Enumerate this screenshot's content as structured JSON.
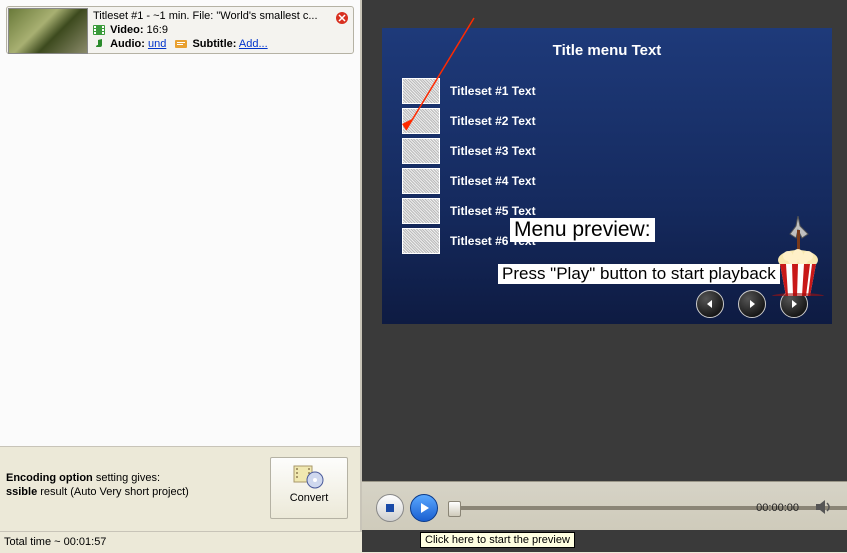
{
  "card": {
    "title": "Titleset #1 - ~1 min. File: \"World's smallest c...",
    "video_lbl": "Video:",
    "video_val": "16:9",
    "audio_lbl": "Audio:",
    "audio_link": "und",
    "subtitle_lbl": "Subtitle:",
    "subtitle_link": "Add..."
  },
  "encoding": {
    "line1_a": "Encoding option",
    "line1_b": " setting gives:",
    "line2_a": "ssible",
    "line2_b": " result (Auto Very short project)"
  },
  "convert_label": "Convert",
  "status": "Total time ~ 00:01:57",
  "dvd": {
    "title": "Title menu Text",
    "items": [
      "Titleset #1 Text",
      "Titleset #2 Text",
      "Titleset #3 Text",
      "Titleset #4 Text",
      "Titleset #5 Text",
      "Titleset #6 Text"
    ],
    "overlay_title": "Menu preview:",
    "overlay_sub": "Press \"Play\" button to start playback"
  },
  "player": {
    "time": "00:00:00",
    "tooltip": "Click here to start the preview"
  }
}
